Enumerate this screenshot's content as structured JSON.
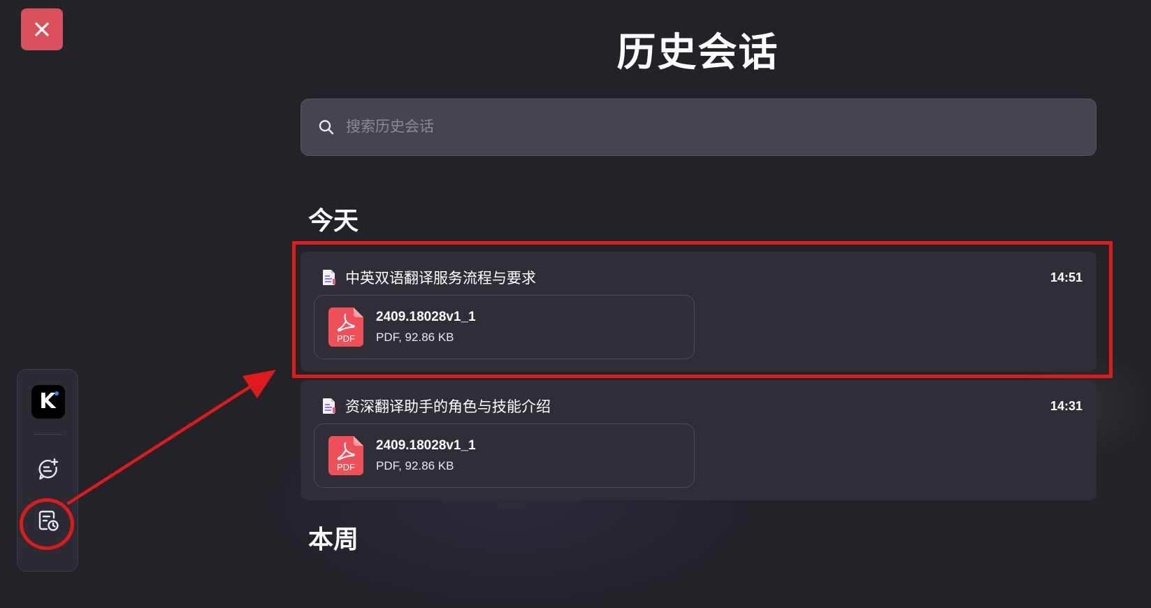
{
  "page": {
    "title": "历史会话"
  },
  "search": {
    "placeholder": "搜索历史会话"
  },
  "sections": [
    {
      "heading": "今天",
      "conversations": [
        {
          "title": "中英双语翻译服务流程与要求",
          "time": "14:51",
          "file": {
            "name": "2409.18028v1_1",
            "meta": "PDF, 92.86 KB",
            "icon_label": "PDF"
          },
          "highlighted": true
        },
        {
          "title": "资深翻译助手的角色与技能介绍",
          "time": "14:31",
          "file": {
            "name": "2409.18028v1_1",
            "meta": "PDF, 92.86 KB",
            "icon_label": "PDF"
          },
          "highlighted": false
        }
      ]
    },
    {
      "heading": "本周",
      "conversations": []
    }
  ],
  "dock": {
    "logo_letter": "K",
    "icons": [
      "app-logo-icon",
      "new-chat-icon",
      "history-icon"
    ]
  },
  "colors": {
    "background": "#222229",
    "card": "#2e2e36",
    "search_bg": "#45454f",
    "close_button": "#d9505c",
    "pdf_red": "#f0505a",
    "annotation_red": "#e01a1a",
    "logo_dot": "#3d7bff"
  }
}
